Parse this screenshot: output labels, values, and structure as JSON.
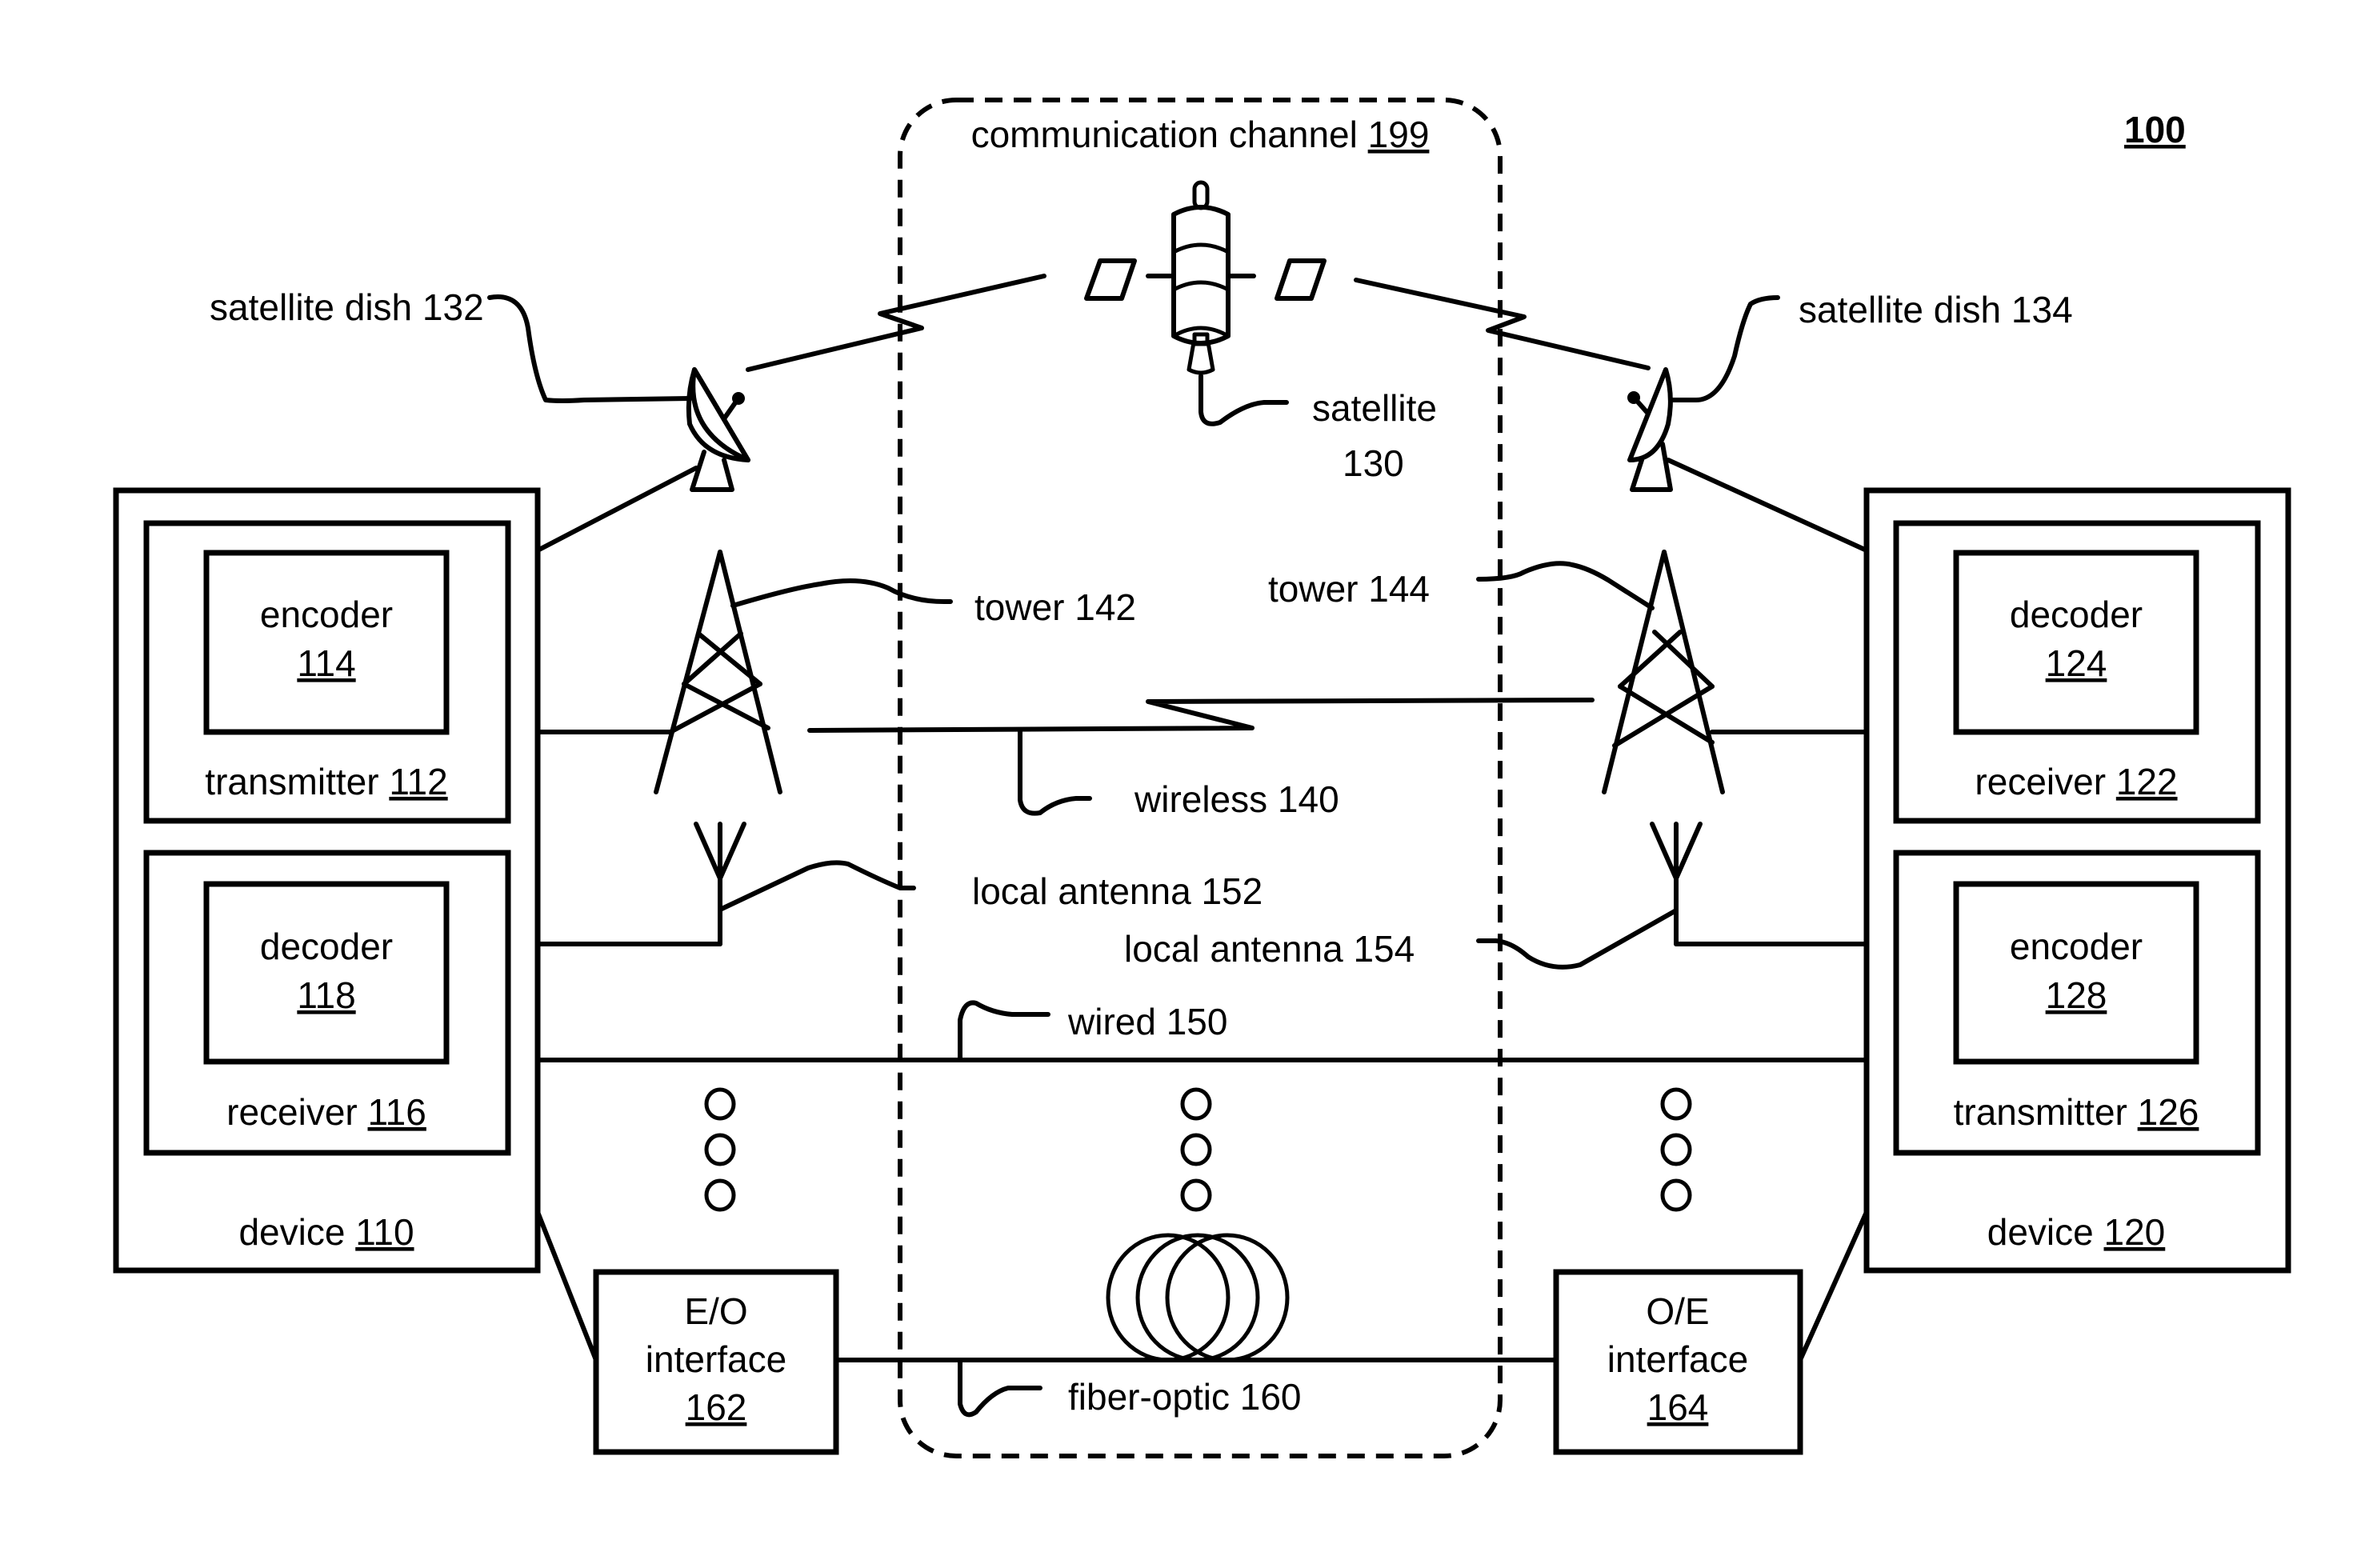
{
  "figure_number": "100",
  "channel": {
    "label": "communication channel",
    "ref": "199"
  },
  "device_left": {
    "label": "device",
    "ref": "110",
    "transmitter": {
      "label": "transmitter",
      "ref": "112",
      "encoder": {
        "label": "encoder",
        "ref": "114"
      }
    },
    "receiver": {
      "label": "receiver",
      "ref": "116",
      "decoder": {
        "label": "decoder",
        "ref": "118"
      }
    }
  },
  "device_right": {
    "label": "device",
    "ref": "120",
    "receiver": {
      "label": "receiver",
      "ref": "122",
      "decoder": {
        "label": "decoder",
        "ref": "124"
      }
    },
    "transmitter": {
      "label": "transmitter",
      "ref": "126",
      "encoder": {
        "label": "encoder",
        "ref": "128"
      }
    }
  },
  "satellite": {
    "label": "satellite",
    "ref": "130"
  },
  "satellite_dish_left": {
    "text": "satellite dish 132"
  },
  "satellite_dish_right": {
    "text": "satellite dish 134"
  },
  "tower_left": {
    "text": "tower 142"
  },
  "tower_right": {
    "text": "tower 144"
  },
  "wireless": {
    "text": "wireless 140"
  },
  "local_antenna_left": {
    "text": "local antenna 152"
  },
  "local_antenna_right": {
    "text": "local antenna 154"
  },
  "wired": {
    "text": "wired 150"
  },
  "fiber_optic": {
    "text": "fiber-optic 160"
  },
  "eo_interface": {
    "line1": "E/O",
    "line2": "interface",
    "ref": "162"
  },
  "oe_interface": {
    "line1": "O/E",
    "line2": "interface",
    "ref": "164"
  }
}
